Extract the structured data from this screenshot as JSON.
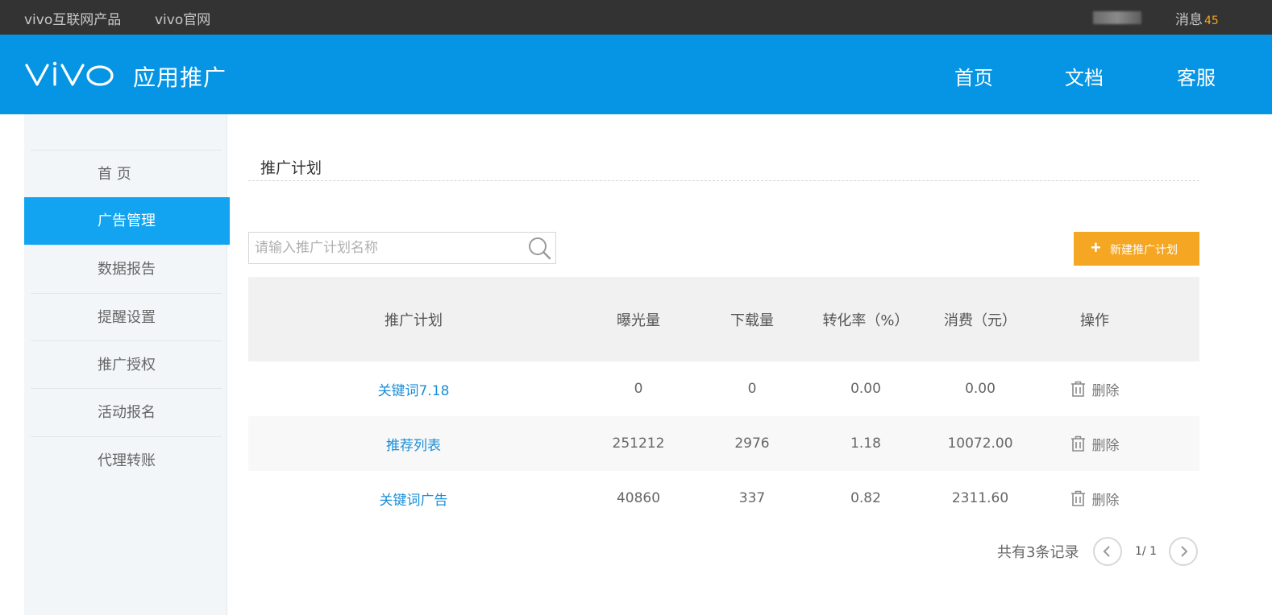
{
  "topbar": {
    "links": [
      "vivo互联网产品",
      "vivo官网"
    ],
    "messages_label": "消息",
    "messages_count": "45"
  },
  "header": {
    "logo_text": "vivo",
    "title": "应用推广",
    "nav": [
      "首页",
      "文档",
      "客服"
    ]
  },
  "sidebar": {
    "items": [
      {
        "label": "首 页",
        "active": false
      },
      {
        "label": "广告管理",
        "active": true
      },
      {
        "label": "数据报告",
        "active": false
      },
      {
        "label": "提醒设置",
        "active": false
      },
      {
        "label": "推广授权",
        "active": false
      },
      {
        "label": "活动报名",
        "active": false
      },
      {
        "label": "代理转账",
        "active": false
      }
    ]
  },
  "main": {
    "section_title": "推广计划",
    "search": {
      "placeholder": "请输入推广计划名称",
      "value": ""
    },
    "new_button_label": "新建推广计划",
    "table": {
      "headers": [
        "推广计划",
        "曝光量",
        "下载量",
        "转化率（%）",
        "消费（元）",
        "操作"
      ],
      "rows": [
        {
          "plan": "关键词7.18",
          "exposure": "0",
          "downloads": "0",
          "conversion": "0.00",
          "cost": "0.00",
          "action": "删除"
        },
        {
          "plan": "推荐列表",
          "exposure": "251212",
          "downloads": "2976",
          "conversion": "1.18",
          "cost": "10072.00",
          "action": "删除"
        },
        {
          "plan": "关键词广告",
          "exposure": "40860",
          "downloads": "337",
          "conversion": "0.82",
          "cost": "2311.60",
          "action": "删除"
        }
      ]
    },
    "pagination": {
      "total_text": "共有3条记录",
      "page_indicator": "1/ 1"
    }
  },
  "colors": {
    "topbar_bg": "#333333",
    "header_bg": "#0595e4",
    "sidebar_active": "#12a4f0",
    "accent_orange": "#f5a623",
    "link_blue": "#1a8fd8"
  },
  "icons": {
    "search": "search-icon",
    "new_plan": "plus-icon",
    "delete": "trash-icon",
    "prev": "chevron-left-icon",
    "next": "chevron-right-icon"
  }
}
